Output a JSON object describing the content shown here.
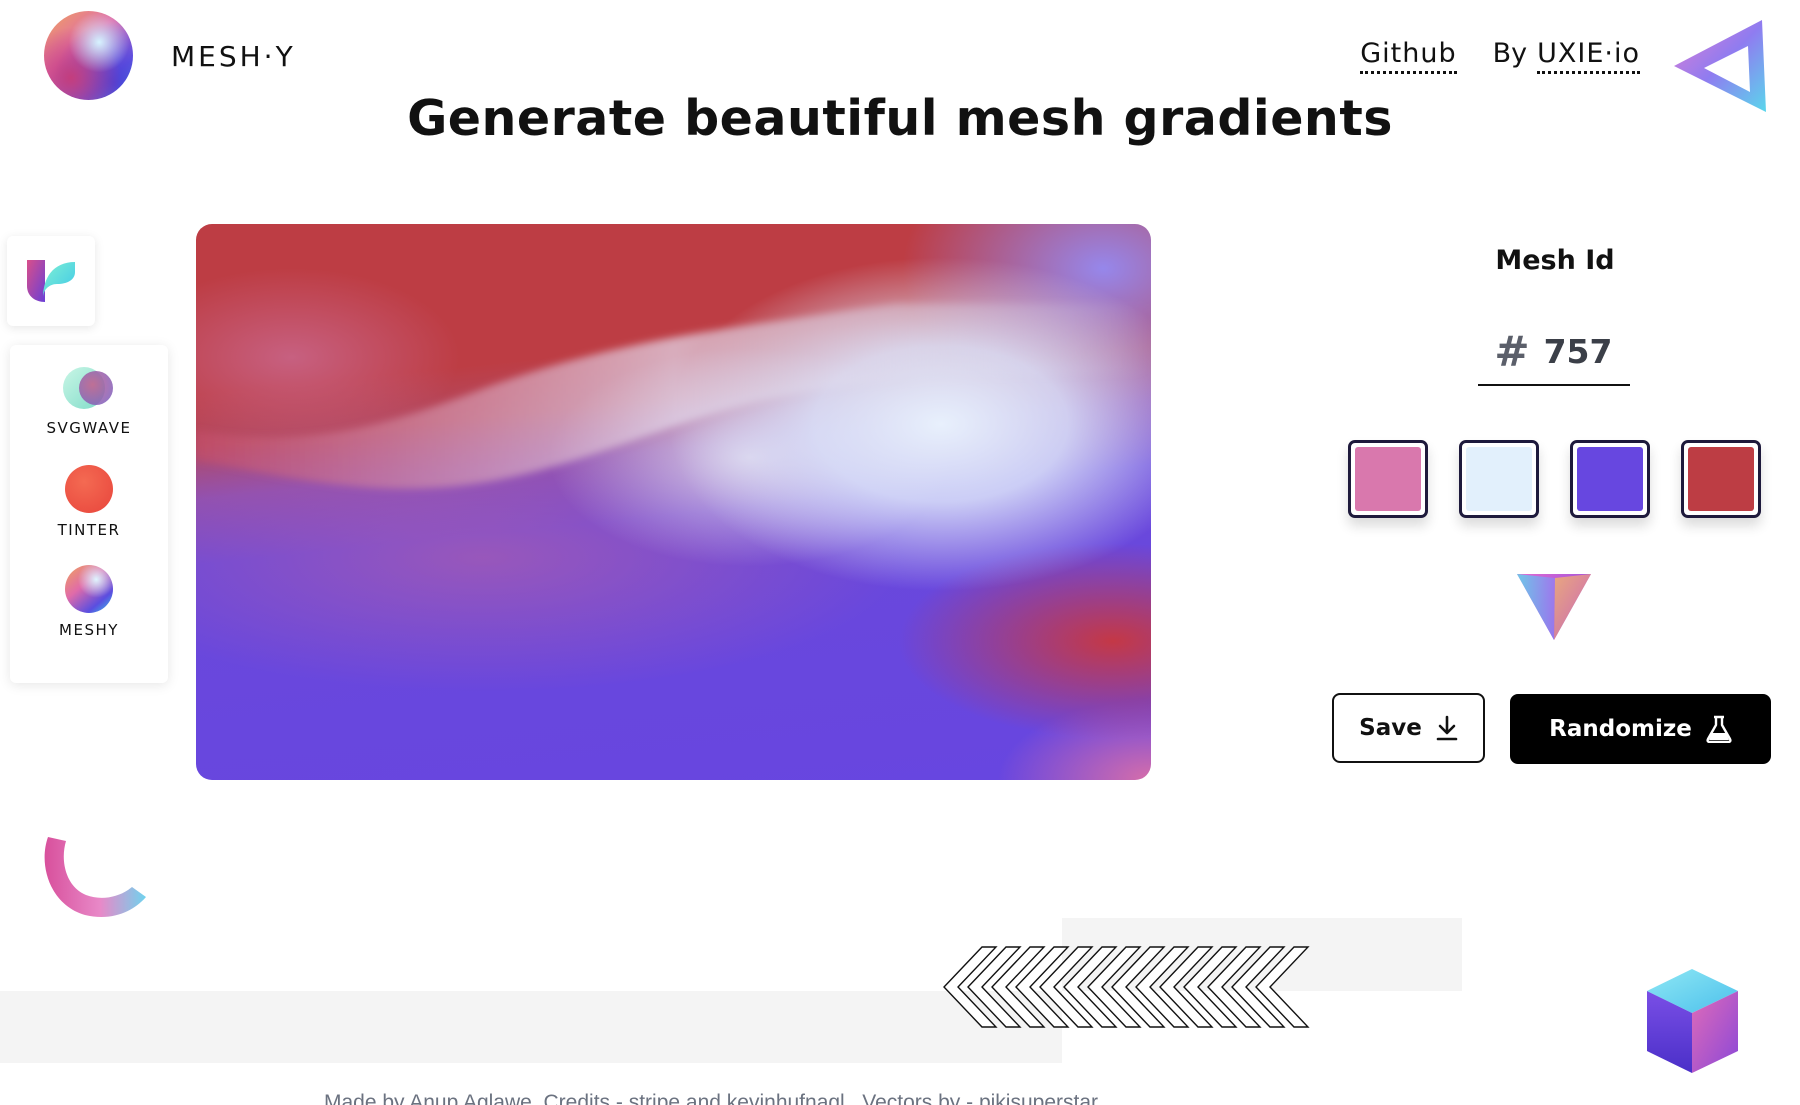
{
  "header": {
    "brand": "MESH·Y",
    "nav": {
      "github_label": "Github",
      "by_prefix": "By",
      "uxie_label": "UXIE·io"
    },
    "headline": "Generate beautiful mesh gradients"
  },
  "sidebar": {
    "items": [
      {
        "label": "SVGWAVE",
        "icon": "svgwave-icon"
      },
      {
        "label": "TINTER",
        "icon": "tinter-icon"
      },
      {
        "label": "MESHY",
        "icon": "meshy-icon"
      }
    ]
  },
  "panel": {
    "mesh_id_label": "Mesh Id",
    "hash_symbol": "#",
    "mesh_id_value": "757",
    "swatches": [
      "#d978ad",
      "#e2f0fc",
      "#6747e0",
      "#bd3d44"
    ],
    "save_label": "Save",
    "randomize_label": "Randomize"
  },
  "footer": {
    "made_by": "Made by",
    "author": "Anup Aglawe",
    "credits": ". Credits -",
    "credit_1": "stripe",
    "and": "and",
    "credit_2": "kevinhufnagl",
    "separator": ".",
    "vectors": "Vectors by - pikisuperstar"
  },
  "colors": {
    "text": "#111111",
    "muted": "#6b7280",
    "button_dark": "#000000",
    "swatch_border": "#1e1a3c"
  }
}
